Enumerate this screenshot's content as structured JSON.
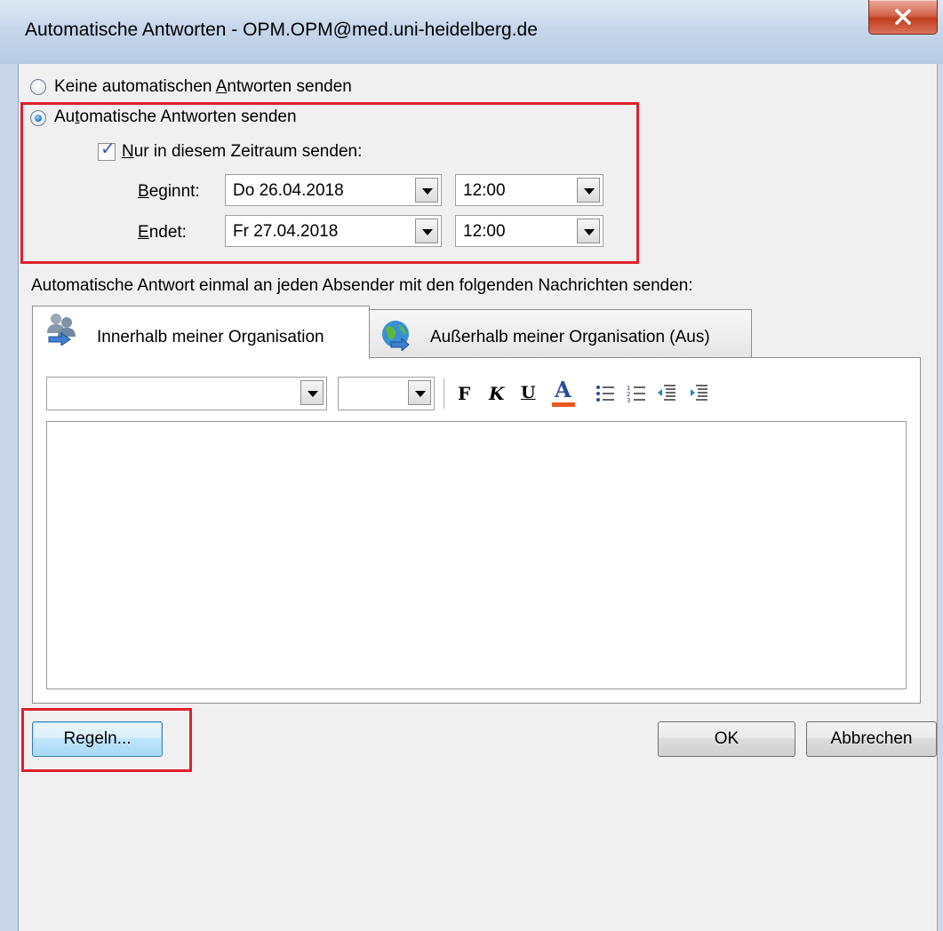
{
  "window": {
    "title": "Automatische Antworten - OPM.OPM@med.uni-heidelberg.de"
  },
  "options": {
    "no_replies": {
      "pre": "Keine automatischen ",
      "key": "A",
      "post": "ntworten senden",
      "selected": false
    },
    "send_replies": {
      "pre": "Au",
      "key": "t",
      "post": "omatische Antworten senden",
      "selected": true
    },
    "time_range": {
      "pre": "",
      "key": "N",
      "post": "ur in diesem Zeitraum senden:",
      "checked": true
    }
  },
  "schedule": {
    "start": {
      "pre": "",
      "key": "B",
      "post": "eginnt:",
      "date": "Do 26.04.2018",
      "time": "12:00"
    },
    "end": {
      "pre": "",
      "key": "E",
      "post": "ndet:",
      "date": "Fr 27.04.2018",
      "time": "12:00"
    }
  },
  "message_label": "Automatische Antwort einmal an jeden Absender mit den folgenden Nachrichten senden:",
  "tabs": [
    {
      "label": "Innerhalb meiner Organisation",
      "active": true,
      "icon": "people-icon"
    },
    {
      "label": "Außerhalb meiner Organisation (Aus)",
      "active": false,
      "icon": "globe-icon"
    }
  ],
  "toolbar": {
    "font_value": "",
    "size_value": "",
    "bold": "F",
    "italic": "K",
    "underline": "U",
    "font_color": "A",
    "font_color_hex": "#e8581c"
  },
  "editor": {
    "content": ""
  },
  "buttons": {
    "rules": "Regeln...",
    "ok": "OK",
    "cancel": "Abbrechen"
  },
  "colors": {
    "highlight": "#e0202e",
    "accent": "#3c7fb1"
  }
}
